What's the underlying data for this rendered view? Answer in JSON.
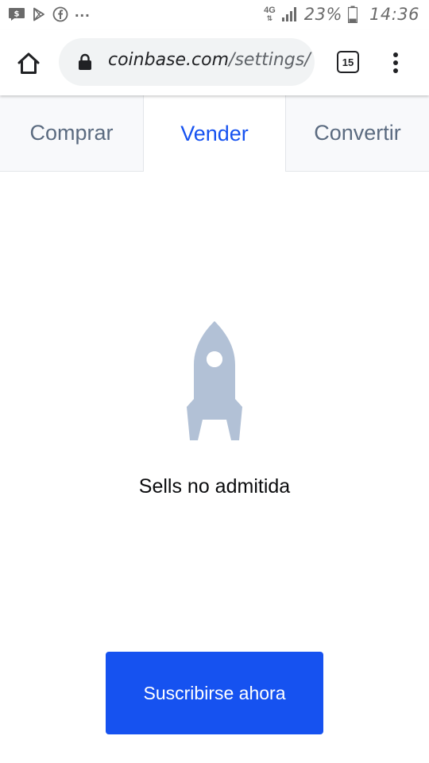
{
  "status_bar": {
    "battery_percent": "23%",
    "time": "14:36",
    "network_type": "4G",
    "overflow": "...",
    "notification_icons": [
      "message-dollar-icon",
      "play-store-icon",
      "facebook-icon"
    ],
    "signal_icon": "signal-icon",
    "battery_icon": "battery-icon"
  },
  "browser": {
    "url_host": "coinbase.com",
    "url_path": "/settings/",
    "tab_count": "15",
    "home_icon": "home-icon",
    "lock_icon": "lock-icon",
    "menu_icon": "more-vertical-icon"
  },
  "tabs": [
    {
      "label": "Comprar",
      "active": false
    },
    {
      "label": "Vender",
      "active": true
    },
    {
      "label": "Convertir",
      "active": false
    }
  ],
  "content": {
    "illustration_icon": "rocket-icon",
    "message": "Sells no admitida",
    "button_label": "Suscribirse ahora"
  },
  "colors": {
    "accent": "#1652f0",
    "tab_inactive_text": "#5b6b80",
    "rocket": "#b2c1d6"
  }
}
